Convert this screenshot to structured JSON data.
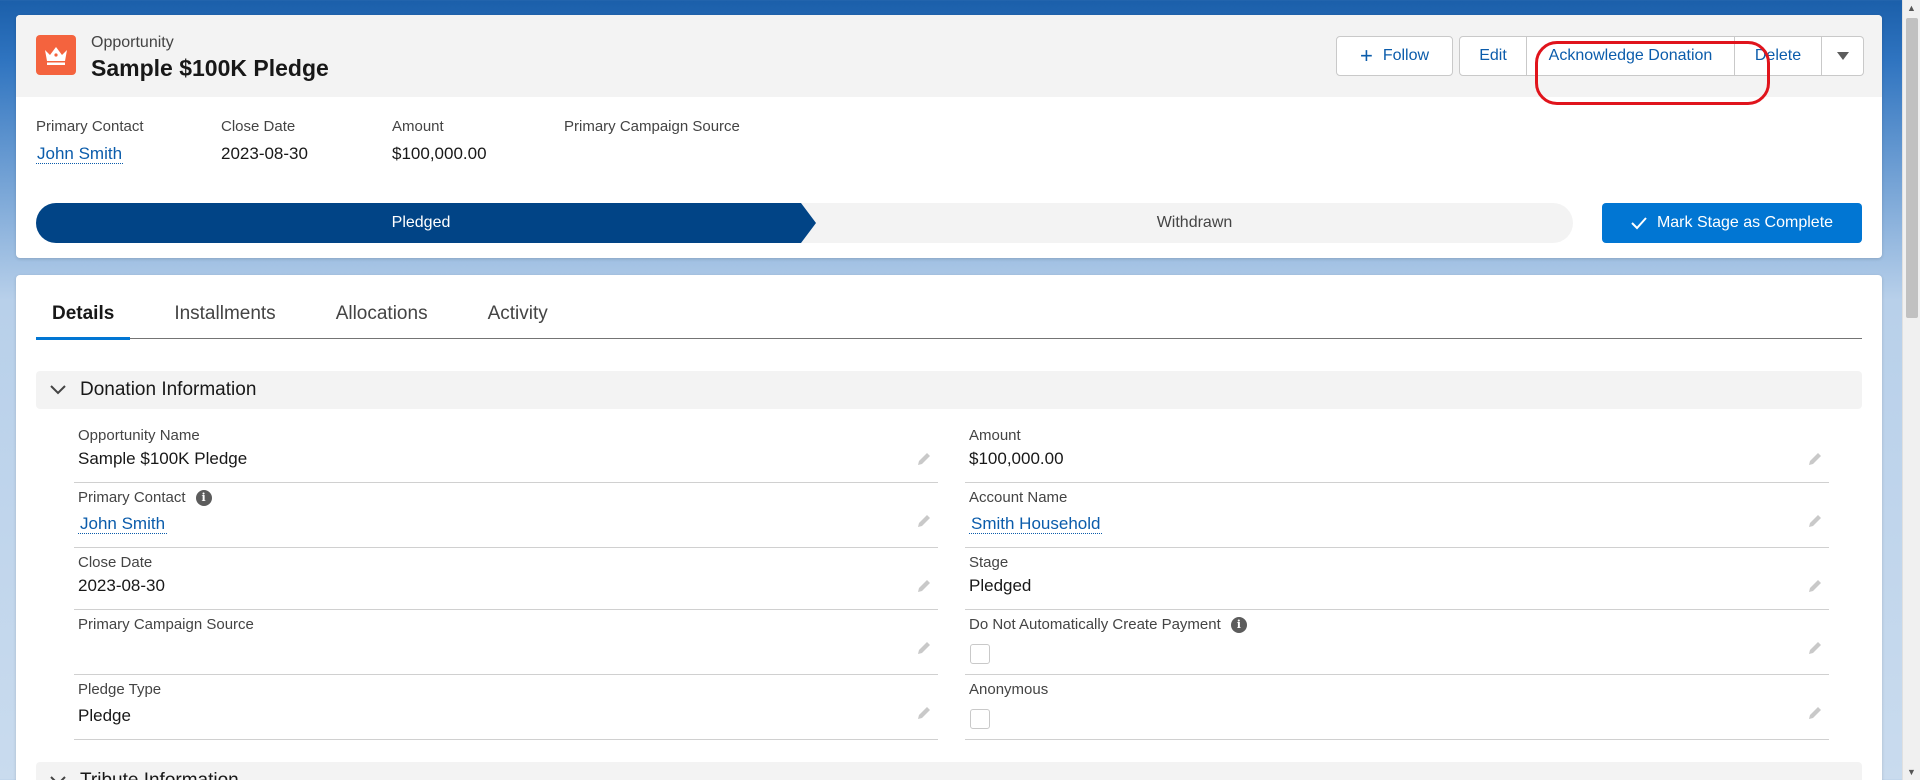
{
  "header": {
    "object_label": "Opportunity",
    "record_title": "Sample $100K Pledge",
    "buttons": {
      "follow": "Follow",
      "edit": "Edit",
      "acknowledge": "Acknowledge Donation",
      "delete": "Delete"
    },
    "highlight_fields": [
      {
        "label": "Primary Contact",
        "value": "John Smith"
      },
      {
        "label": "Close Date",
        "value": "2023-08-30"
      },
      {
        "label": "Amount",
        "value": "$100,000.00"
      },
      {
        "label": "Primary Campaign Source",
        "value": ""
      }
    ],
    "path": {
      "active_stage": "Pledged",
      "next_stage": "Withdrawn"
    },
    "mark_complete_label": "Mark Stage as Complete"
  },
  "tabs": [
    {
      "label": "Details"
    },
    {
      "label": "Installments"
    },
    {
      "label": "Allocations"
    },
    {
      "label": "Activity"
    }
  ],
  "sections": {
    "donation_information": "Donation Information",
    "tribute_information": "Tribute Information"
  },
  "fields": {
    "opportunity_name": {
      "label": "Opportunity Name",
      "value": "Sample $100K Pledge"
    },
    "amount": {
      "label": "Amount",
      "value": "$100,000.00"
    },
    "primary_contact": {
      "label": "Primary Contact",
      "value": "John Smith"
    },
    "account_name": {
      "label": "Account Name",
      "value": "Smith Household"
    },
    "close_date": {
      "label": "Close Date",
      "value": "2023-08-30"
    },
    "stage": {
      "label": "Stage",
      "value": "Pledged"
    },
    "primary_campaign_source": {
      "label": "Primary Campaign Source",
      "value": ""
    },
    "do_not_auto_create_payment": {
      "label": "Do Not Automatically Create Payment",
      "checked": false
    },
    "pledge_type": {
      "label": "Pledge Type",
      "value": "Pledge"
    },
    "anonymous": {
      "label": "Anonymous",
      "checked": false
    }
  },
  "colors": {
    "brand_blue": "#0176d3",
    "path_active": "#014486",
    "object_icon": "#f4633e",
    "highlight_outline": "#e0141c"
  }
}
